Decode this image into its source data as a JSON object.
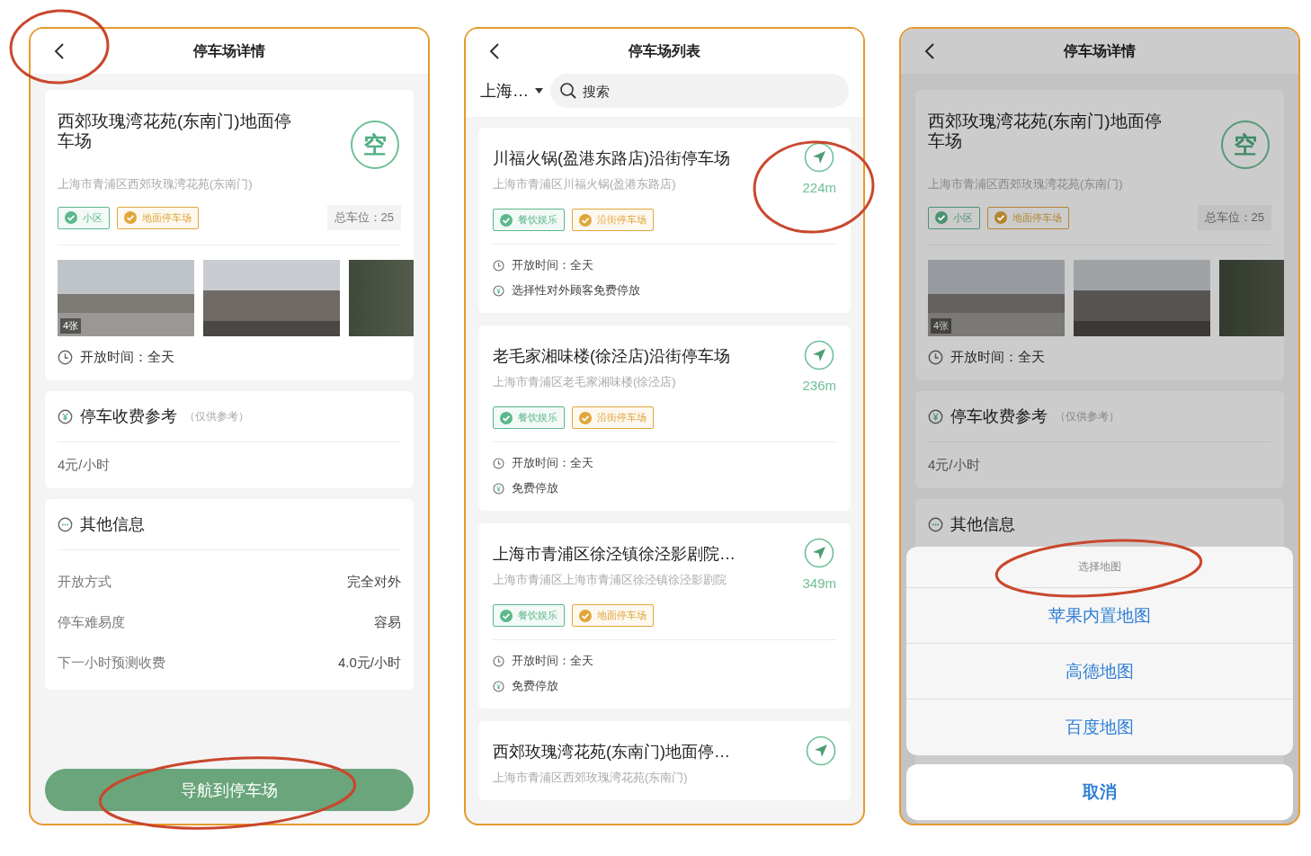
{
  "screens": [
    {
      "kind": "detail",
      "title": "停车场详情",
      "lot": {
        "name": "西郊玫瑰湾花苑(东南门)地面停车场",
        "address": "上海市青浦区西郊玫瑰湾花苑(东南门)",
        "status": "空",
        "tags": [
          {
            "label": "小区",
            "color": "#5cb88c"
          },
          {
            "label": "地面停车场",
            "color": "#e0a63a"
          }
        ],
        "capacity": "总车位：25",
        "photo_badge": "4张",
        "hours": "开放时间：全天"
      },
      "fee": {
        "title": "停车收费参考",
        "note": "（仅供参考）",
        "value": "4元/小时"
      },
      "other": {
        "title": "其他信息",
        "rows": [
          {
            "label": "开放方式",
            "value": "完全对外"
          },
          {
            "label": "停车难易度",
            "value": "容易"
          },
          {
            "label": "下一小时预测收费",
            "value": "4.0元/小时"
          }
        ]
      },
      "navigate_button": "导航到停车场"
    },
    {
      "kind": "list",
      "title": "停车场列表",
      "city": "上海…",
      "search": {
        "placeholder": "搜索"
      },
      "items": [
        {
          "name": "川福火锅(盈港东路店)沿街停车场",
          "address": "上海市青浦区川福火锅(盈港东路店)",
          "distance": "224m",
          "tags": [
            {
              "label": "餐饮娱乐",
              "color": "#5cb88c"
            },
            {
              "label": "沿街停车场",
              "color": "#e0a63a"
            }
          ],
          "info": [
            {
              "kind": "hours",
              "text": "开放时间：全天"
            },
            {
              "kind": "fee",
              "text": "选择性对外顾客免费停放"
            }
          ]
        },
        {
          "name": "老毛家湘味楼(徐泾店)沿街停车场",
          "address": "上海市青浦区老毛家湘味楼(徐泾店)",
          "distance": "236m",
          "tags": [
            {
              "label": "餐饮娱乐",
              "color": "#5cb88c"
            },
            {
              "label": "沿街停车场",
              "color": "#e0a63a"
            }
          ],
          "info": [
            {
              "kind": "hours",
              "text": "开放时间：全天"
            },
            {
              "kind": "fee",
              "text": "免费停放"
            }
          ]
        },
        {
          "name": "上海市青浦区徐泾镇徐泾影剧院…",
          "address": "上海市青浦区上海市青浦区徐泾镇徐泾影剧院",
          "distance": "349m",
          "tags": [
            {
              "label": "餐饮娱乐",
              "color": "#5cb88c"
            },
            {
              "label": "地面停车场",
              "color": "#e0a63a"
            }
          ],
          "info": [
            {
              "kind": "hours",
              "text": "开放时间：全天"
            },
            {
              "kind": "fee",
              "text": "免费停放"
            }
          ]
        },
        {
          "name": "西郊玫瑰湾花苑(东南门)地面停…",
          "address": "上海市青浦区西郊玫瑰湾花苑(东南门)"
        }
      ]
    },
    {
      "kind": "detail",
      "title": "停车场详情",
      "lot": {
        "name": "西郊玫瑰湾花苑(东南门)地面停车场",
        "address": "上海市青浦区西郊玫瑰湾花苑(东南门)",
        "status": "空",
        "tags": [
          {
            "label": "小区",
            "color": "#4a9370"
          },
          {
            "label": "地面停车场",
            "color": "#b3852e"
          }
        ],
        "capacity": "总车位：25",
        "photo_badge": "4张",
        "hours": "开放时间：全天"
      },
      "fee": {
        "title": "停车收费参考",
        "note": "（仅供参考）",
        "value": "4元/小时"
      },
      "other": {
        "title": "其他信息"
      },
      "dimmed": true,
      "action_sheet": {
        "title": "选择地图",
        "options": [
          "苹果内置地图",
          "高德地图",
          "百度地图"
        ],
        "cancel": "取消"
      }
    }
  ]
}
